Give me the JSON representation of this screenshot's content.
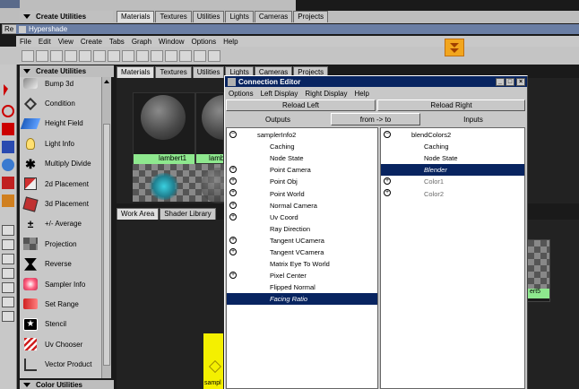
{
  "outer": {
    "create_utilities": "Create Utilities",
    "tabs": [
      {
        "label": "Materials"
      },
      {
        "label": "Textures"
      },
      {
        "label": "Utilities"
      },
      {
        "label": "Lights"
      },
      {
        "label": "Cameras"
      },
      {
        "label": "Projects"
      }
    ],
    "left_tab": "Re"
  },
  "hypershade": {
    "title": "Hypershade",
    "menu": [
      {
        "label": "File"
      },
      {
        "label": "Edit"
      },
      {
        "label": "View"
      },
      {
        "label": "Create"
      },
      {
        "label": "Tabs"
      },
      {
        "label": "Graph"
      },
      {
        "label": "Window"
      },
      {
        "label": "Options"
      },
      {
        "label": "Help"
      }
    ],
    "create_utilities": "Create Utilities",
    "color_utilities": "Color Utilities",
    "nodes": [
      {
        "label": "Bump 3d",
        "icon": "bump-3d-icon"
      },
      {
        "label": "Condition",
        "icon": "condition-icon"
      },
      {
        "label": "Height Field",
        "icon": "height-field-icon"
      },
      {
        "label": "Light Info",
        "icon": "light-info-icon"
      },
      {
        "label": "Multiply Divide",
        "icon": "multiply-divide-icon"
      },
      {
        "label": "2d Placement",
        "icon": "2d-placement-icon"
      },
      {
        "label": "3d Placement",
        "icon": "3d-placement-icon"
      },
      {
        "label": "+/- Average",
        "icon": "plus-minus-average-icon"
      },
      {
        "label": "Projection",
        "icon": "projection-icon"
      },
      {
        "label": "Reverse",
        "icon": "reverse-icon"
      },
      {
        "label": "Sampler Info",
        "icon": "sampler-info-icon"
      },
      {
        "label": "Set Range",
        "icon": "set-range-icon"
      },
      {
        "label": "Stencil",
        "icon": "stencil-icon"
      },
      {
        "label": "Uv Chooser",
        "icon": "uv-chooser-icon"
      },
      {
        "label": "Vector Product",
        "icon": "vector-product-icon"
      }
    ],
    "tabs": [
      {
        "label": "Materials"
      },
      {
        "label": "Textures"
      },
      {
        "label": "Utilities"
      },
      {
        "label": "Lights"
      },
      {
        "label": "Cameras"
      },
      {
        "label": "Projects"
      }
    ],
    "swatch1": "lambert1",
    "swatch2": "lamb",
    "work_tabs": [
      {
        "label": "Work Area"
      },
      {
        "label": "Shader Library"
      }
    ],
    "node_rt": "ert5",
    "node_yellow": "sampl"
  },
  "ce": {
    "title": "Connection Editor",
    "menu": [
      {
        "label": "Options"
      },
      {
        "label": "Left Display"
      },
      {
        "label": "Right Display"
      },
      {
        "label": "Help"
      }
    ],
    "reload_left": "Reload Left",
    "reload_right": "Reload Right",
    "outputs": "Outputs",
    "direction": "from -> to",
    "inputs": "Inputs",
    "left": [
      {
        "label": "samplerInfo2",
        "indent": 1,
        "node": true
      },
      {
        "label": "Caching",
        "indent": 2
      },
      {
        "label": "Node State",
        "indent": 2
      },
      {
        "label": "Point Camera",
        "indent": 2,
        "plus": true
      },
      {
        "label": "Point Obj",
        "indent": 2,
        "plus": true
      },
      {
        "label": "Point World",
        "indent": 2,
        "plus": true
      },
      {
        "label": "Normal Camera",
        "indent": 2,
        "plus": true
      },
      {
        "label": "Uv Coord",
        "indent": 2,
        "plus": true
      },
      {
        "label": "Ray Direction",
        "indent": 2
      },
      {
        "label": "Tangent UCamera",
        "indent": 2,
        "plus": true
      },
      {
        "label": "Tangent VCamera",
        "indent": 2,
        "plus": true
      },
      {
        "label": "Matrix Eye To World",
        "indent": 2
      },
      {
        "label": "Pixel Center",
        "indent": 2,
        "plus": true
      },
      {
        "label": "Flipped Normal",
        "indent": 2
      },
      {
        "label": "Facing Ratio",
        "indent": 2,
        "sel": true
      }
    ],
    "right": [
      {
        "label": "blendColors2",
        "indent": 1,
        "node": true
      },
      {
        "label": "Caching",
        "indent": 2
      },
      {
        "label": "Node State",
        "indent": 2
      },
      {
        "label": "Blender",
        "indent": 2,
        "sel": true
      },
      {
        "label": "Color1",
        "indent": 2,
        "plus": true,
        "dim": true
      },
      {
        "label": "Color2",
        "indent": 2,
        "plus": true,
        "dim": true
      }
    ]
  },
  "colors": {
    "selection": "#082460",
    "titlebar": "#082460",
    "maya_bg": "#c8c8c8",
    "swatch_label": "#8ee88e"
  }
}
